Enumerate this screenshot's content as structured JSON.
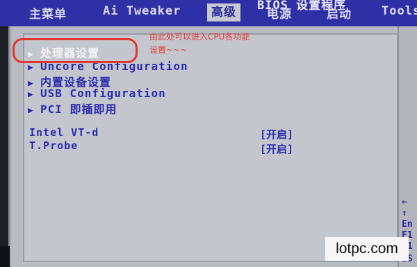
{
  "bios": {
    "title": "BIOS 设置程序"
  },
  "tabs": [
    {
      "label": "主菜单"
    },
    {
      "label": "Ai Tweaker"
    },
    {
      "label": "高级"
    },
    {
      "label": "电源"
    },
    {
      "label": "启动"
    },
    {
      "label": "Tools"
    }
  ],
  "menu": [
    {
      "label": "处理器设置"
    },
    {
      "label": "Uncore Configuration"
    },
    {
      "label": "内置设备设置"
    },
    {
      "label": "USB Configuration"
    },
    {
      "label": "PCI 即插即用"
    }
  ],
  "settings": [
    {
      "label": "Intel VT-d",
      "value": "[开启]"
    },
    {
      "label": "T.Probe",
      "value": "[开启]"
    }
  ],
  "annotation": {
    "line1": "由此处可以进入CPU各功能",
    "line2": "设置~~~"
  },
  "help_keys": [
    "←",
    "↑",
    "En",
    "F1",
    "F1",
    "ES"
  ],
  "watermark": "lotpc.com",
  "colors": {
    "menu_bar": "#2f2fa6",
    "panel": "#c4c6cd",
    "item_text": "#2b2bb0",
    "annotation": "#e33a33"
  }
}
